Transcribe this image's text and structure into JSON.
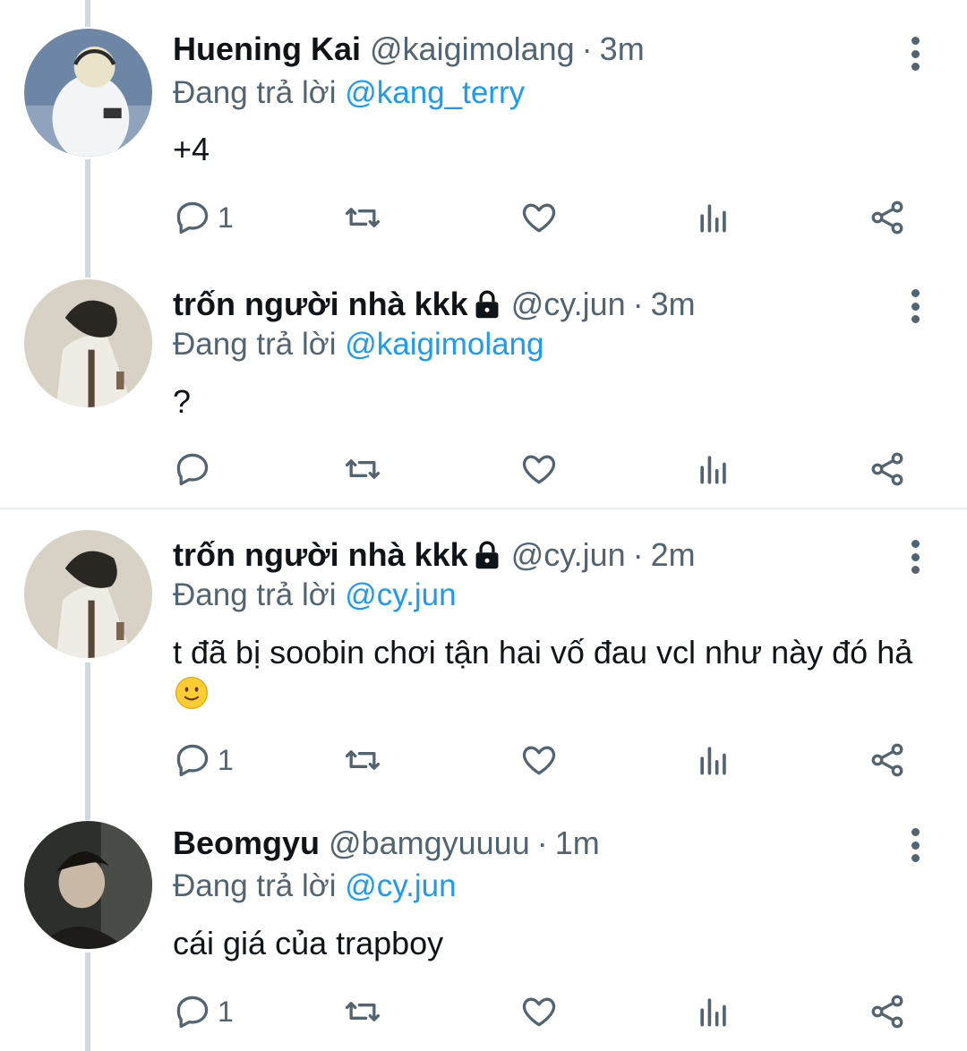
{
  "replying_label": "Đang trả lời",
  "tweets": [
    {
      "name": "Huening Kai",
      "handle": "@kaigimolang",
      "time": "3m",
      "replying_to": "@kang_terry",
      "text": "+4",
      "reply_count": "1",
      "locked": false
    },
    {
      "name": "trốn người nhà kkk",
      "handle": "@cy.jun",
      "time": "3m",
      "replying_to": "@kaigimolang",
      "text": "?",
      "reply_count": "",
      "locked": true
    },
    {
      "name": "trốn người nhà kkk",
      "handle": "@cy.jun",
      "time": "2m",
      "replying_to": "@cy.jun",
      "text": "t đã bị soobin chơi tận hai vố đau vcl như này đó hả",
      "reply_count": "1",
      "locked": true,
      "emoji": "slightly-smiling-face"
    },
    {
      "name": "Beomgyu",
      "handle": "@bamgyuuuu",
      "time": "1m",
      "replying_to": "@cy.jun",
      "text": "cái giá của trapboy",
      "reply_count": "1",
      "locked": false
    }
  ],
  "icons": [
    "reply-icon",
    "retweet-icon",
    "like-icon",
    "analytics-icon",
    "share-icon",
    "more-options-icon",
    "lock-icon"
  ],
  "colors": {
    "link": "#1d9bf0",
    "secondary": "#536471",
    "thread_line": "#cfd9de"
  }
}
